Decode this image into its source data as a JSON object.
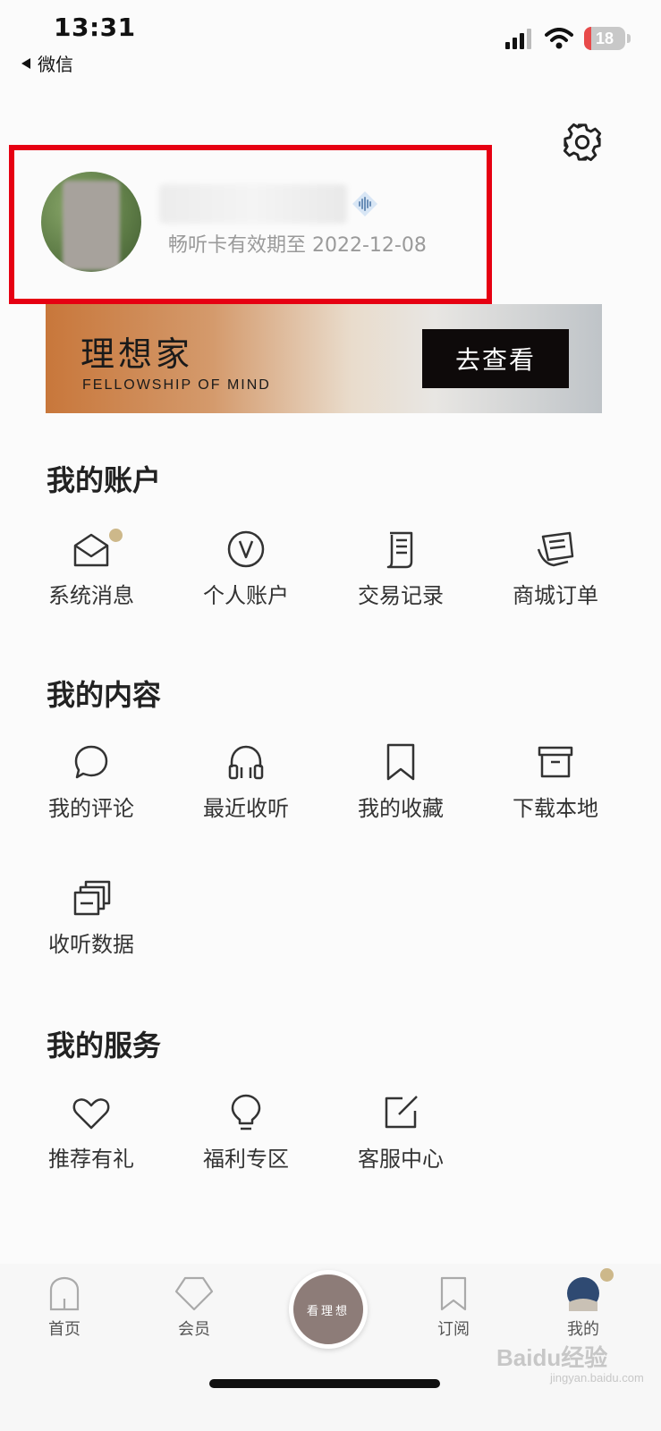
{
  "status_bar": {
    "time": "13:31",
    "back_app": "微信",
    "battery": "18"
  },
  "profile": {
    "valid_text": "畅听卡有效期至 2022-12-08"
  },
  "banner": {
    "title": "理想家",
    "subtitle": "FELLOWSHIP OF MIND",
    "button": "去查看"
  },
  "account": {
    "title": "我的账户",
    "items": [
      {
        "label": "系统消息",
        "icon": "envelope-icon",
        "has_dot": true
      },
      {
        "label": "个人账户",
        "icon": "v-circle-icon"
      },
      {
        "label": "交易记录",
        "icon": "receipt-icon"
      },
      {
        "label": "商城订单",
        "icon": "orders-icon"
      }
    ]
  },
  "content": {
    "title": "我的内容",
    "items": [
      {
        "label": "我的评论",
        "icon": "comment-icon"
      },
      {
        "label": "最近收听",
        "icon": "headphones-icon"
      },
      {
        "label": "我的收藏",
        "icon": "bookmark-icon"
      },
      {
        "label": "下载本地",
        "icon": "archive-icon"
      },
      {
        "label": "收听数据",
        "icon": "stack-icon"
      }
    ]
  },
  "services": {
    "title": "我的服务",
    "items": [
      {
        "label": "推荐有礼",
        "icon": "heart-icon"
      },
      {
        "label": "福利专区",
        "icon": "lightbulb-icon"
      },
      {
        "label": "客服中心",
        "icon": "edit-icon"
      }
    ]
  },
  "tabbar": {
    "items": [
      {
        "label": "首页",
        "icon": "home-icon"
      },
      {
        "label": "会员",
        "icon": "diamond-icon"
      },
      {
        "label": "看理想",
        "icon": "center-logo"
      },
      {
        "label": "订阅",
        "icon": "bookmark-icon"
      },
      {
        "label": "我的",
        "icon": "avatar-icon",
        "active": true
      }
    ]
  },
  "watermark": {
    "brand": "Baidu经验",
    "url": "jingyan.baidu.com"
  },
  "colors": {
    "highlight": "#e60012",
    "dot": "#cdb88a",
    "banner_button": "#0e0a0a"
  }
}
